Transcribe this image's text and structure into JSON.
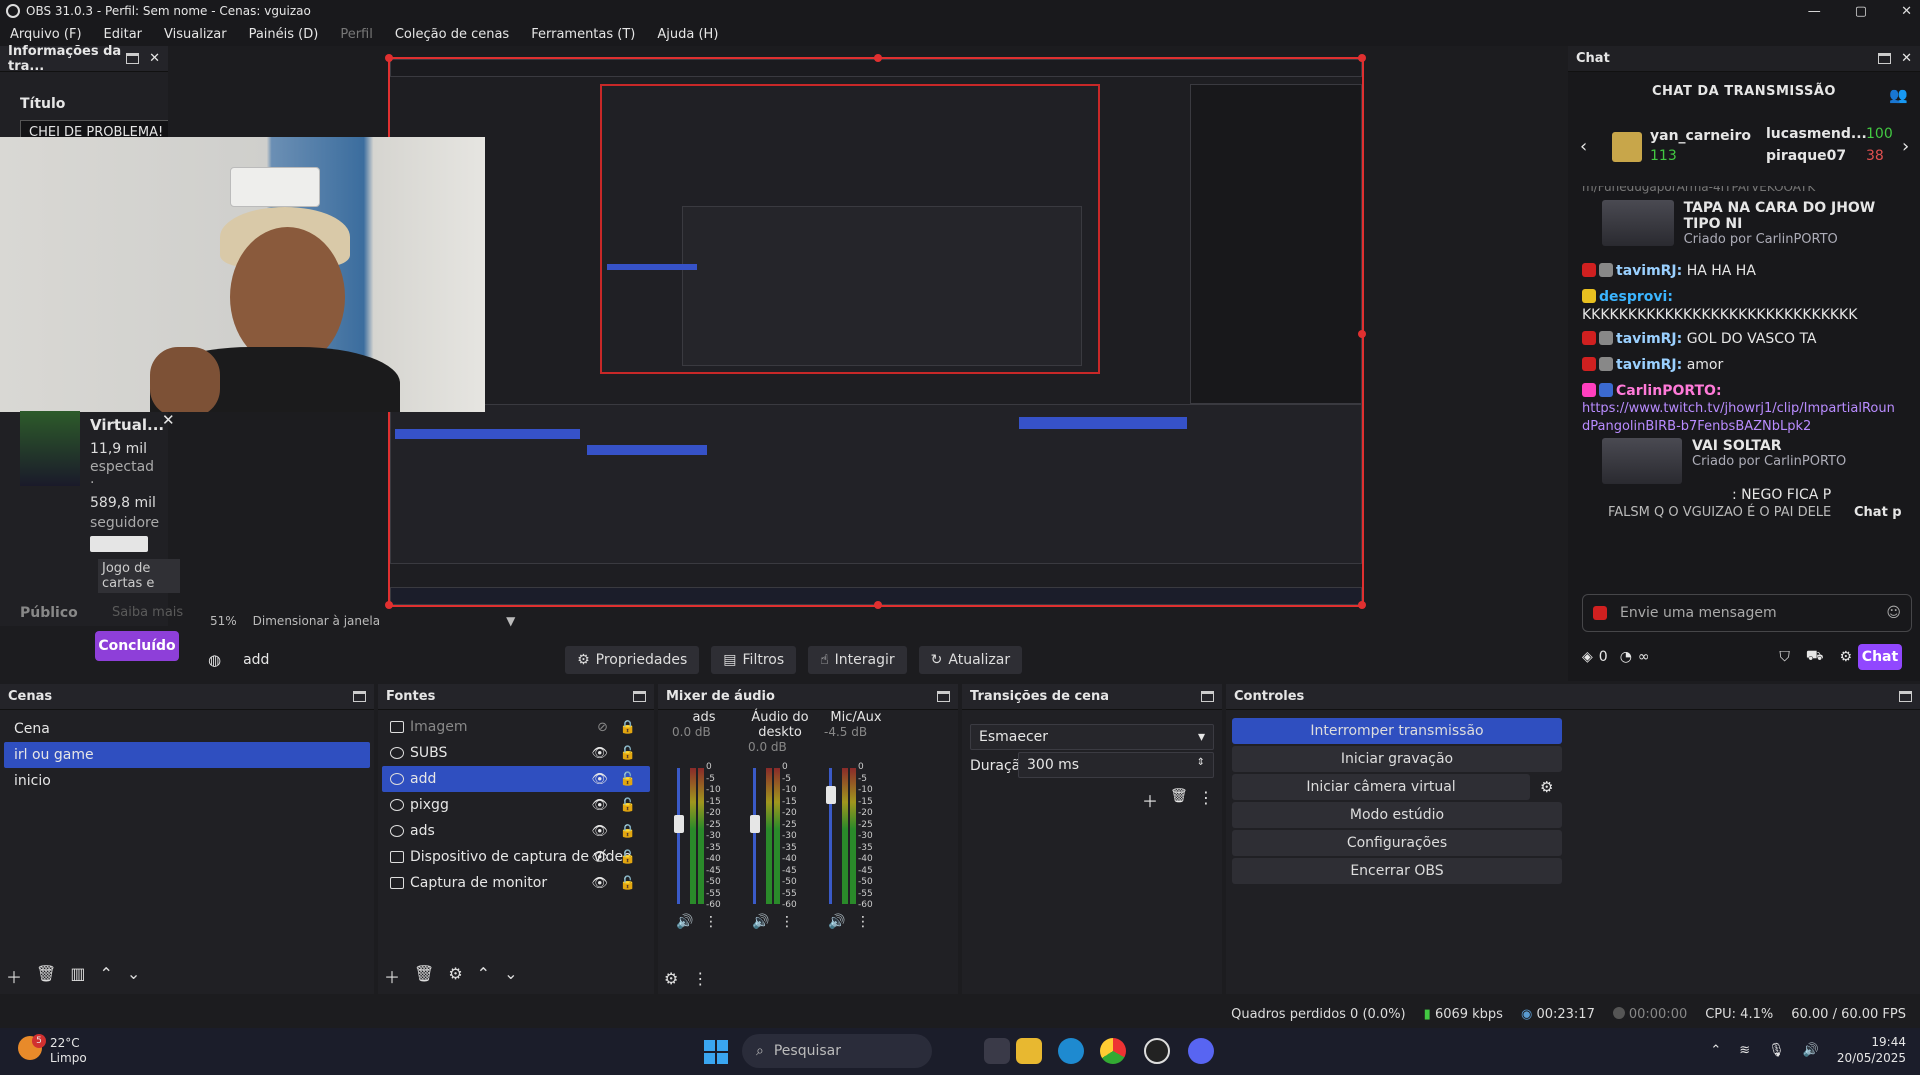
{
  "window": {
    "title": "OBS 31.0.3 - Perfil: Sem nome - Cenas: vguizao",
    "minimize": "—",
    "maximize": "▢",
    "close": "✕"
  },
  "menu": [
    "Arquivo (F)",
    "Editar",
    "Visualizar",
    "Painéis (D)",
    "Perfil",
    "Coleção de cenas",
    "Ferramentas (T)",
    "Ajuda (H)"
  ],
  "info_dock": {
    "header": "Informações da tra...",
    "title_label": "Título",
    "title_value": "CHEI DE PROBLEMA!",
    "card": {
      "name": "Virtual...",
      "views": "11,9 mil",
      "views_label": "espectad",
      "dot": "·",
      "followers": "589,8 mil",
      "followers_label": "seguidore",
      "category": "Jogo de cartas e"
    },
    "audience_label": "Público",
    "learn_more": "Saiba mais",
    "done_button": "Concluído"
  },
  "preview": {
    "zoom": "51%",
    "zoom_mode": "Dimensionar à janela"
  },
  "source_toolbar": {
    "source_name": "add",
    "properties": "Propriedades",
    "filters": "Filtros",
    "interact": "Interagir",
    "refresh": "Atualizar"
  },
  "chat": {
    "header": "Chat",
    "title": "CHAT DA TRANSMISSÃO",
    "gifters": [
      {
        "name": "yan_carneiro",
        "count": "113"
      },
      {
        "name": "lucasmend...",
        "count": "100"
      },
      {
        "name": "piraque07",
        "count": "38"
      }
    ],
    "top_partial": "m/FunedugaporArma-4ITPArVEKOOATK",
    "messages": [
      {
        "type": "clip",
        "title": "TAPA NA CARA DO JHOW TIPO NI",
        "by": "Criado por CarlinPORTO"
      },
      {
        "type": "msg",
        "user": "tavimRJ:",
        "text": " HA HA HA",
        "color": "#9ad0ff"
      },
      {
        "type": "msg",
        "user": "desprovi:",
        "text": "",
        "color": "#3bb5ff"
      },
      {
        "type": "text",
        "text": "KKKKKKKKKKKKKKKKKKKKKKKKKKKKKK"
      },
      {
        "type": "msg",
        "user": "tavimRJ:",
        "text": " GOL DO VASCO TA",
        "color": "#9ad0ff"
      },
      {
        "type": "msg",
        "user": "tavimRJ:",
        "text": " amor",
        "color": "#9ad0ff"
      },
      {
        "type": "msg",
        "user": "CarlinPORTO:",
        "text": "",
        "color": "#ff7ad9"
      },
      {
        "type": "link",
        "text": "https://www.twitch.tv/jhowrj1/clip/ImpartialRoundPangolinBIRB-b7FenbsBAZNbLpk2"
      },
      {
        "type": "clip",
        "title": "VAI SOLTAR",
        "by": "Criado por CarlinPORTO"
      },
      {
        "type": "msg",
        "user": ": NEGO FICA P",
        "text": "",
        "color": "#e0e0e0"
      },
      {
        "type": "text",
        "text": "FALSM Q O VGUIZAO É O PAI DELE"
      }
    ],
    "chat_p": "Chat p",
    "input_placeholder": "Envie uma mensagem",
    "points": "0",
    "infinity": "∞",
    "send_button": "Chat"
  },
  "scenes": {
    "header": "Cenas",
    "items": [
      "Cena",
      "irl ou game",
      "inicio"
    ],
    "selected": 1
  },
  "sources": {
    "header": "Fontes",
    "items": [
      "Imagem",
      "SUBS",
      "add",
      "pixgg",
      "ads",
      "Dispositivo de captura de vídeo",
      "Captura de monitor"
    ]
  },
  "mixer": {
    "header": "Mixer de áudio",
    "channels": [
      {
        "name": "ads",
        "db": "0.0 dB",
        "level": 0.6
      },
      {
        "name": "Áudio do deskto",
        "db": "0.0 dB",
        "level": 0.6
      },
      {
        "name": "Mic/Aux",
        "db": "-4.5 dB",
        "level": 0.85
      }
    ],
    "scale": [
      "0",
      "-5",
      "-10",
      "-15",
      "-20",
      "-25",
      "-30",
      "-35",
      "-40",
      "-45",
      "-50",
      "-55",
      "-60"
    ]
  },
  "transitions": {
    "header": "Transições de cena",
    "selected": "Esmaecer",
    "duration_label": "Duração",
    "duration_value": "300 ms"
  },
  "controls": {
    "header": "Controles",
    "buttons": [
      "Interromper transmissão",
      "Iniciar gravação",
      "Iniciar câmera virtual",
      "Modo estúdio",
      "Configurações",
      "Encerrar OBS"
    ]
  },
  "status": {
    "dropped": "Quadros perdidos 0 (0.0%)",
    "bitrate": "6069 kbps",
    "live_time": "00:23:17",
    "rec_time": "00:00:00",
    "cpu": "CPU: 4.1%",
    "fps": "60.00 / 60.00 FPS"
  },
  "taskbar": {
    "temp": "22°C",
    "weather": "Limpo",
    "badge": "5",
    "search": "Pesquisar",
    "time": "19:44",
    "date": "20/05/2025"
  }
}
